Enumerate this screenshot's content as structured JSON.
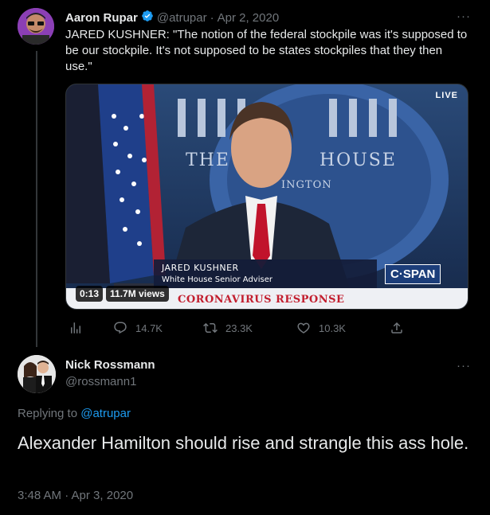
{
  "tweet": {
    "author_name": "Aaron Rupar",
    "handle": "@atrupar",
    "separator": "·",
    "date": "Apr 2, 2020",
    "more_label": "···",
    "text": "JARED KUSHNER: \"The notion of the federal stockpile was it's supposed to be our stockpile. It's not supposed to be states stockpiles that they then use.\"",
    "video": {
      "live_label": "LIVE",
      "backdrop_text": "THE WHITE HOUSE",
      "backdrop_subtext": "WASHINGTON",
      "lower_third_name": "JARED KUSHNER",
      "lower_third_title": "White House Senior Adviser",
      "network_logo": "C·SPAN",
      "banner_text": "CORONAVIRUS RESPONSE",
      "timecode": "0:13",
      "views": "11.7M views"
    },
    "actions": {
      "analytics_icon": "bar-chart-icon",
      "reply_count": "14.7K",
      "retweet_count": "23.3K",
      "like_count": "10.3K",
      "share_icon": "share-icon"
    },
    "verified_color": "#1d9bf0"
  },
  "reply": {
    "author_name": "Nick Rossmann",
    "handle": "@rossmann1",
    "more_label": "···",
    "replying_prefix": "Replying to ",
    "replying_mention": "@atrupar",
    "text": "Alexander Hamilton should rise and strangle this ass hole.",
    "timestamp": "3:48 AM · Apr 3, 2020"
  },
  "colors": {
    "background": "#000000",
    "text_primary": "#e7e9ea",
    "text_secondary": "#71767b",
    "accent": "#1d9bf0"
  }
}
